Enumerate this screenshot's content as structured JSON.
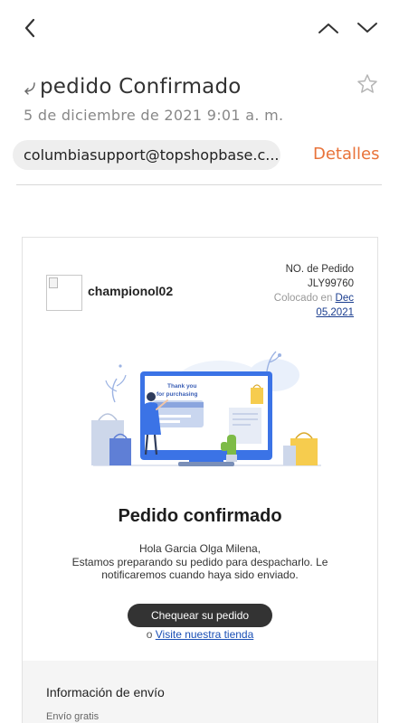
{
  "toolbar": {
    "back_icon": "chevron-left-icon",
    "prev_icon": "chevron-up-icon",
    "next_icon": "chevron-down-icon"
  },
  "email": {
    "subject": "pedido Confirmado",
    "date": "5 de diciembre de 2021  9:01 a. m.",
    "sender": "columbiasupport@topshopbase.c...",
    "details_label": "Detalles",
    "starred": false
  },
  "order": {
    "store_name": "championol02",
    "order_no_label": "NO. de Pedido",
    "order_no": "JLY99760",
    "placed_label": "Colocado en",
    "placed_date_line1": "Dec",
    "placed_date_line2": "05,2021"
  },
  "illustration": {
    "screen_text_line1": "Thank you",
    "screen_text_line2": "for purchasing"
  },
  "content": {
    "headline": "Pedido confirmado",
    "greeting": "Hola Garcia Olga Milena,",
    "message": "Estamos preparando su pedido para despacharlo. Le notificaremos cuando haya sido enviado.",
    "cta_label": "Chequear su pedido",
    "alt_prefix": "o",
    "alt_link": "Visite nuestra tienda"
  },
  "shipping": {
    "title": "Información de envío",
    "method": "Envío gratis"
  },
  "colors": {
    "accent": "#e8733a",
    "link": "#1a3d8f",
    "button": "#333333"
  }
}
